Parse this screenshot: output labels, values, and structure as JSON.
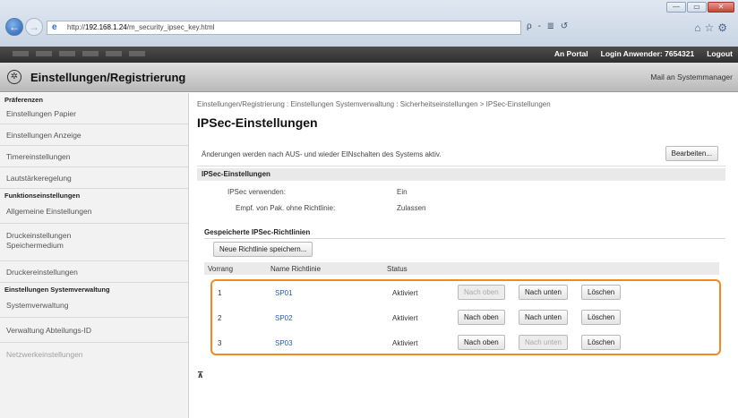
{
  "browser": {
    "url_prefix": "http://",
    "url_host": "192.168.1.24",
    "url_path": "/m_security_ipsec_key.html",
    "address_tools": "ρ - ≣ ↺",
    "window_controls": [
      "—",
      "▭",
      "✕"
    ]
  },
  "topbar": {
    "portal": "An Portal",
    "login_label": "Login Anwender:",
    "login_user": "7654321",
    "logout": "Logout"
  },
  "header": {
    "title": "Einstellungen/Registrierung",
    "mail": "Mail an Systemmanager"
  },
  "sidebar": {
    "sections": [
      {
        "heading": "Präferenzen",
        "items": [
          "Einstellungen Papier",
          "Einstellungen Anzeige",
          "Timereinstellungen",
          "Lautstärkeregelung"
        ]
      },
      {
        "heading": "Funktionseinstellungen",
        "items": [
          "Allgemeine Einstellungen",
          "Druckeinstellungen Speichermedium",
          "Druckereinstellungen"
        ]
      },
      {
        "heading": "Einstellungen Systemverwaltung",
        "items": [
          "Systemverwaltung",
          "Verwaltung Abteilungs-ID",
          "Netzwerkeinstellungen"
        ]
      }
    ]
  },
  "main": {
    "breadcrumb": "Einstellungen/Registrierung : Einstellungen Systemverwaltung : Sicherheitseinstellungen > IPSec-Einstellungen",
    "title": "IPSec-Einstellungen",
    "notice": "Änderungen werden nach AUS- und wieder EINschalten des Systems aktiv.",
    "edit_button": "Bearbeiten...",
    "section_title": "IPSec-Einstellungen",
    "use_label": "IPSec verwenden:",
    "use_value": "Ein",
    "receive_label": "Empf. von Pak. ohne Richtlinie:",
    "receive_value": "Zulassen",
    "saved_title": "Gespeicherte IPSec-Richtlinien",
    "save_policy_button": "Neue Richtlinie speichern...",
    "columns": [
      "Vorrang",
      "Name Richtlinie",
      "Status"
    ],
    "rows": [
      {
        "priority": "1",
        "name": "SP01",
        "status": "Aktiviert",
        "up": "Nach oben",
        "down": "Nach unten",
        "delete": "Löschen"
      },
      {
        "priority": "2",
        "name": "SP02",
        "status": "Aktiviert",
        "up": "Nach oben",
        "down": "Nach unten",
        "delete": "Löschen"
      },
      {
        "priority": "3",
        "name": "SP03",
        "status": "Aktiviert",
        "up": "Nach oben",
        "down": "Nach unten",
        "delete": "Löschen"
      }
    ],
    "to_top": "⊼"
  },
  "colors": {
    "highlight": "#f28a1e",
    "link": "#2a5db0",
    "topbar": "#3a3a3a"
  }
}
